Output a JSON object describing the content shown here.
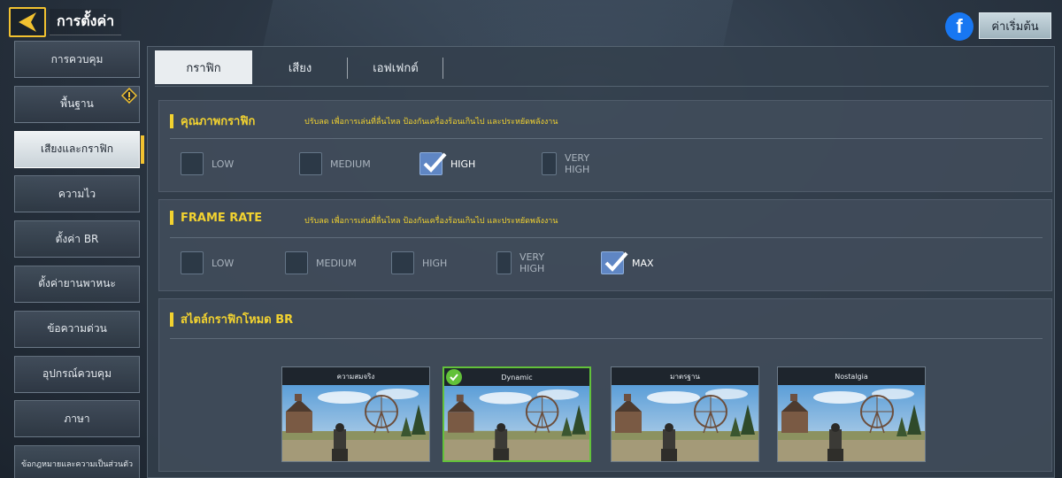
{
  "header": {
    "title": "การตั้งค่า",
    "reset_label": "ค่าเริ่มต้น",
    "fb_letter": "f"
  },
  "sidebar": {
    "items": [
      {
        "label": "การควบคุม"
      },
      {
        "label": "พื้นฐาน",
        "warning": true
      },
      {
        "label": "เสียงและกราฟิก",
        "active": true
      },
      {
        "label": "ความไว"
      },
      {
        "label": "ตั้งค่า BR"
      },
      {
        "label": "ตั้งค่ายานพาหนะ"
      },
      {
        "label": "ข้อความด่วน"
      },
      {
        "label": "อุปกรณ์ควบคุม"
      },
      {
        "label": "ภาษา"
      },
      {
        "label": "ข้อกฎหมายและความเป็นส่วนตัว"
      }
    ]
  },
  "tabs": [
    {
      "label": "กราฟิก",
      "active": true
    },
    {
      "label": "เสียง"
    },
    {
      "label": "เอฟเฟกต์"
    }
  ],
  "graphics_quality": {
    "title": "คุณภาพกราฟิก",
    "desc": "ปรับลด เพื่อการเล่นที่ลื่นไหล ป้องกันเครื่องร้อนเกินไป และประหยัดพลังงาน",
    "options": [
      {
        "label": "LOW",
        "checked": false
      },
      {
        "label": "MEDIUM",
        "checked": false
      },
      {
        "label": "HIGH",
        "checked": true
      },
      {
        "label": "VERY HIGH",
        "checked": false
      }
    ]
  },
  "frame_rate": {
    "title": "FRAME RATE",
    "desc": "ปรับลด เพื่อการเล่นที่ลื่นไหล ป้องกันเครื่องร้อนเกินไป และประหยัดพลังงาน",
    "options": [
      {
        "label": "LOW",
        "checked": false
      },
      {
        "label": "MEDIUM",
        "checked": false
      },
      {
        "label": "HIGH",
        "checked": false
      },
      {
        "label": "VERY HIGH",
        "checked": false
      },
      {
        "label": "MAX",
        "checked": true
      }
    ]
  },
  "br_style": {
    "title": "สไตล์กราฟิกโหมด BR",
    "styles": [
      {
        "label": "ความสมจริง",
        "selected": false
      },
      {
        "label": "Dynamic",
        "selected": true
      },
      {
        "label": "มาตรฐาน",
        "selected": false
      },
      {
        "label": "Nostalgia",
        "selected": false
      }
    ]
  },
  "colors": {
    "accent": "#f2c230",
    "checked": "#5f86c4",
    "selected_border": "#62c13a"
  }
}
